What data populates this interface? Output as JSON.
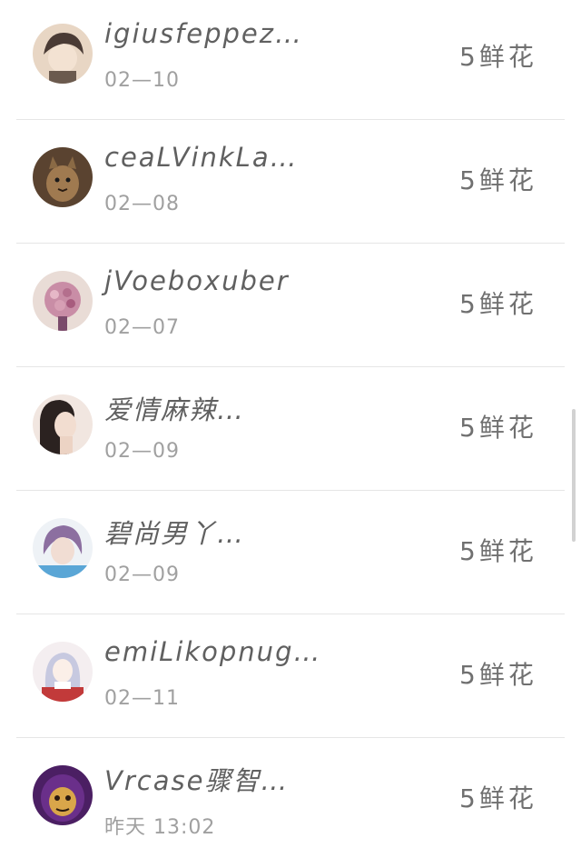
{
  "gifts": [
    {
      "name": "igiusfeppez…",
      "date": "02—10",
      "reward": "5鲜花",
      "avatar": "anime-boy-avatar",
      "colors": [
        "#6b5a4e",
        "#e8d6c4"
      ]
    },
    {
      "name": "ceaLVinkLa…",
      "date": "02—08",
      "reward": "5鲜花",
      "avatar": "kitten-avatar",
      "colors": [
        "#8a6a45",
        "#3d2e22"
      ]
    },
    {
      "name": "jVoeboxuber",
      "date": "02—07",
      "reward": "5鲜花",
      "avatar": "flower-bouquet-avatar",
      "colors": [
        "#c98da6",
        "#7a4a6a"
      ]
    },
    {
      "name": "爱情麻辣…",
      "date": "02—09",
      "reward": "5鲜花",
      "avatar": "woman-portrait-avatar",
      "colors": [
        "#2b2220",
        "#e9d8cc"
      ]
    },
    {
      "name": "碧尚男丫…",
      "date": "02—09",
      "reward": "5鲜花",
      "avatar": "purple-hair-avatar",
      "colors": [
        "#8c6fa0",
        "#5aa6d6"
      ]
    },
    {
      "name": "emiLikopnug…",
      "date": "02—11",
      "reward": "5鲜花",
      "avatar": "anime-girl-avatar",
      "colors": [
        "#c7c9e0",
        "#c23a3a"
      ]
    },
    {
      "name": "Vrcase骤智…",
      "date": "昨天 13:02",
      "reward": "5鲜花",
      "avatar": "purple-cartoon-avatar",
      "colors": [
        "#6a2f8a",
        "#d9a64a"
      ]
    }
  ]
}
